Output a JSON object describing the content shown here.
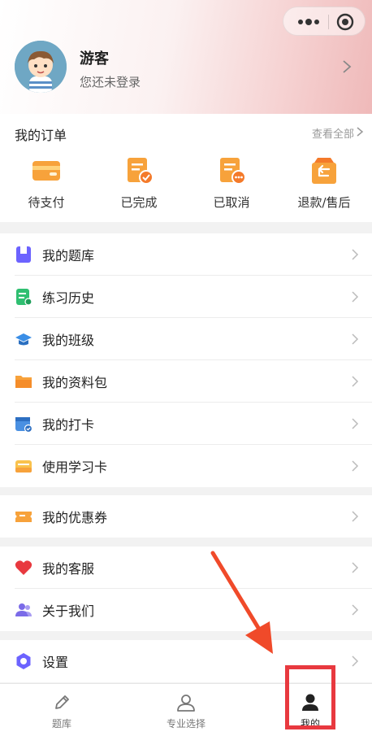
{
  "header": {
    "user_name": "游客",
    "user_status": "您还未登录"
  },
  "orders": {
    "title": "我的订单",
    "view_all": "查看全部",
    "items": [
      {
        "label": "待支付",
        "icon": "wallet-icon"
      },
      {
        "label": "已完成",
        "icon": "order-done-icon"
      },
      {
        "label": "已取消",
        "icon": "order-cancel-icon"
      },
      {
        "label": "退款/售后",
        "icon": "refund-icon"
      }
    ]
  },
  "menu_group_1": [
    {
      "label": "我的题库",
      "icon": "question-bank-icon"
    },
    {
      "label": "练习历史",
      "icon": "history-icon"
    },
    {
      "label": "我的班级",
      "icon": "graduation-cap-icon"
    },
    {
      "label": "我的资料包",
      "icon": "folder-icon"
    },
    {
      "label": "我的打卡",
      "icon": "calendar-check-icon"
    },
    {
      "label": "使用学习卡",
      "icon": "card-icon"
    }
  ],
  "menu_group_2": [
    {
      "label": "我的优惠券",
      "icon": "coupon-icon"
    }
  ],
  "menu_group_3": [
    {
      "label": "我的客服",
      "icon": "heart-service-icon"
    },
    {
      "label": "关于我们",
      "icon": "people-icon"
    }
  ],
  "menu_group_4": [
    {
      "label": "设置",
      "icon": "settings-icon"
    }
  ],
  "tabbar": {
    "items": [
      {
        "label": "题库",
        "icon": "pencil-icon",
        "active": false
      },
      {
        "label": "专业选择",
        "icon": "person-outline-icon",
        "active": false
      },
      {
        "label": "我的",
        "icon": "person-filled-icon",
        "active": true
      }
    ]
  },
  "colors": {
    "accent_red": "#e8393f",
    "orange": "#f7a23b"
  }
}
